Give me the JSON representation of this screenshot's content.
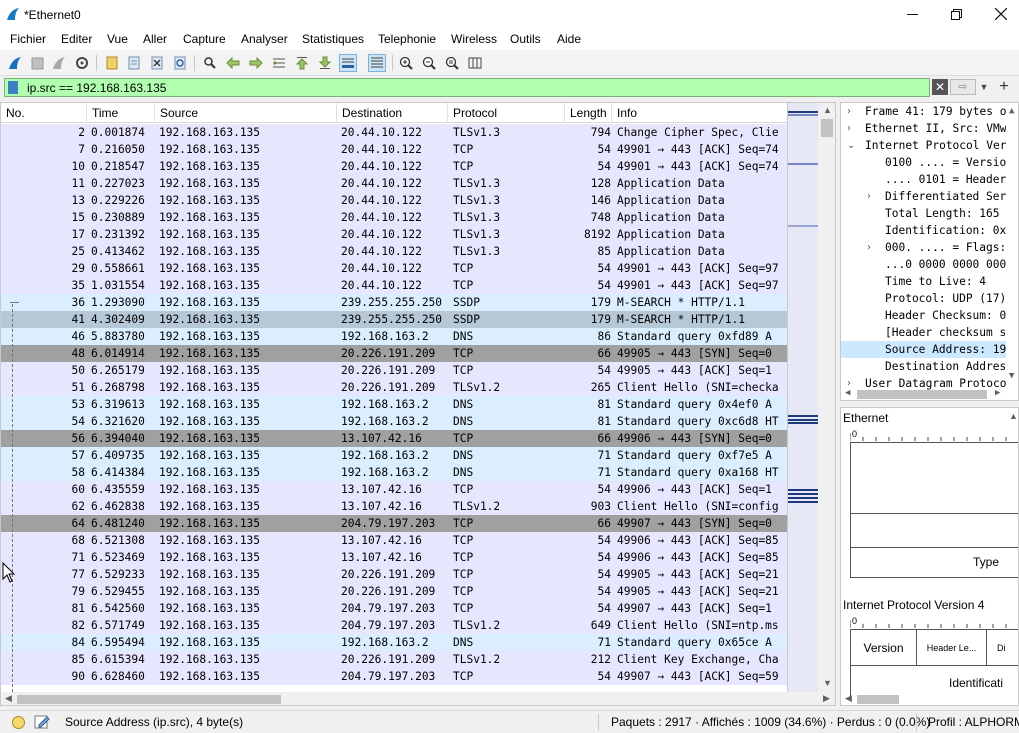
{
  "window": {
    "title": "*Ethernet0"
  },
  "menu": [
    "Fichier",
    "Editer",
    "Vue",
    "Aller",
    "Capture",
    "Analyser",
    "Statistiques",
    "Telephonie",
    "Wireless",
    "Outils",
    "Aide"
  ],
  "filter": {
    "value": "ip.src == 192.168.163.135",
    "apply_label": "⇨"
  },
  "columns": {
    "no": "No.",
    "time": "Time",
    "source": "Source",
    "destination": "Destination",
    "protocol": "Protocol",
    "length": "Length",
    "info": "Info"
  },
  "packets": [
    {
      "no": "2",
      "time": "0.001874",
      "src": "192.168.163.135",
      "dst": "20.44.10.122",
      "proto": "TLSv1.3",
      "len": "794",
      "info": "Change Cipher Spec, Clie",
      "bg": "#e7e6ff"
    },
    {
      "no": "7",
      "time": "0.216050",
      "src": "192.168.163.135",
      "dst": "20.44.10.122",
      "proto": "TCP",
      "len": "54",
      "info": "49901 → 443 [ACK] Seq=74",
      "bg": "#e7e6ff"
    },
    {
      "no": "10",
      "time": "0.218547",
      "src": "192.168.163.135",
      "dst": "20.44.10.122",
      "proto": "TCP",
      "len": "54",
      "info": "49901 → 443 [ACK] Seq=74",
      "bg": "#e7e6ff"
    },
    {
      "no": "11",
      "time": "0.227023",
      "src": "192.168.163.135",
      "dst": "20.44.10.122",
      "proto": "TLSv1.3",
      "len": "128",
      "info": "Application Data",
      "bg": "#e7e6ff"
    },
    {
      "no": "13",
      "time": "0.229226",
      "src": "192.168.163.135",
      "dst": "20.44.10.122",
      "proto": "TLSv1.3",
      "len": "146",
      "info": "Application Data",
      "bg": "#e7e6ff"
    },
    {
      "no": "15",
      "time": "0.230889",
      "src": "192.168.163.135",
      "dst": "20.44.10.122",
      "proto": "TLSv1.3",
      "len": "748",
      "info": "Application Data",
      "bg": "#e7e6ff"
    },
    {
      "no": "17",
      "time": "0.231392",
      "src": "192.168.163.135",
      "dst": "20.44.10.122",
      "proto": "TLSv1.3",
      "len": "8192",
      "info": "Application Data",
      "bg": "#e7e6ff"
    },
    {
      "no": "25",
      "time": "0.413462",
      "src": "192.168.163.135",
      "dst": "20.44.10.122",
      "proto": "TLSv1.3",
      "len": "85",
      "info": "Application Data",
      "bg": "#e7e6ff"
    },
    {
      "no": "29",
      "time": "0.558661",
      "src": "192.168.163.135",
      "dst": "20.44.10.122",
      "proto": "TCP",
      "len": "54",
      "info": "49901 → 443 [ACK] Seq=97",
      "bg": "#e7e6ff"
    },
    {
      "no": "35",
      "time": "1.031554",
      "src": "192.168.163.135",
      "dst": "20.44.10.122",
      "proto": "TCP",
      "len": "54",
      "info": "49901 → 443 [ACK] Seq=97",
      "bg": "#e7e6ff"
    },
    {
      "no": "36",
      "time": "1.293090",
      "src": "192.168.163.135",
      "dst": "239.255.255.250",
      "proto": "SSDP",
      "len": "179",
      "info": "M-SEARCH * HTTP/1.1",
      "bg": "#daeeff"
    },
    {
      "no": "41",
      "time": "4.302409",
      "src": "192.168.163.135",
      "dst": "239.255.255.250",
      "proto": "SSDP",
      "len": "179",
      "info": "M-SEARCH * HTTP/1.1",
      "bg": "#b6c8d6"
    },
    {
      "no": "46",
      "time": "5.883780",
      "src": "192.168.163.135",
      "dst": "192.168.163.2",
      "proto": "DNS",
      "len": "86",
      "info": "Standard query 0xfd89 A",
      "bg": "#daeeff"
    },
    {
      "no": "48",
      "time": "6.014914",
      "src": "192.168.163.135",
      "dst": "20.226.191.209",
      "proto": "TCP",
      "len": "66",
      "info": "49905 → 443 [SYN] Seq=0",
      "bg": "#a0a0a0"
    },
    {
      "no": "50",
      "time": "6.265179",
      "src": "192.168.163.135",
      "dst": "20.226.191.209",
      "proto": "TCP",
      "len": "54",
      "info": "49905 → 443 [ACK] Seq=1",
      "bg": "#e7e6ff"
    },
    {
      "no": "51",
      "time": "6.268798",
      "src": "192.168.163.135",
      "dst": "20.226.191.209",
      "proto": "TLSv1.2",
      "len": "265",
      "info": "Client Hello (SNI=checka",
      "bg": "#e7e6ff"
    },
    {
      "no": "53",
      "time": "6.319613",
      "src": "192.168.163.135",
      "dst": "192.168.163.2",
      "proto": "DNS",
      "len": "81",
      "info": "Standard query 0x4ef0 A",
      "bg": "#daeeff"
    },
    {
      "no": "54",
      "time": "6.321620",
      "src": "192.168.163.135",
      "dst": "192.168.163.2",
      "proto": "DNS",
      "len": "81",
      "info": "Standard query 0xc6d8 HT",
      "bg": "#daeeff"
    },
    {
      "no": "56",
      "time": "6.394040",
      "src": "192.168.163.135",
      "dst": "13.107.42.16",
      "proto": "TCP",
      "len": "66",
      "info": "49906 → 443 [SYN] Seq=0",
      "bg": "#a0a0a0"
    },
    {
      "no": "57",
      "time": "6.409735",
      "src": "192.168.163.135",
      "dst": "192.168.163.2",
      "proto": "DNS",
      "len": "71",
      "info": "Standard query 0xf7e5 A",
      "bg": "#daeeff"
    },
    {
      "no": "58",
      "time": "6.414384",
      "src": "192.168.163.135",
      "dst": "192.168.163.2",
      "proto": "DNS",
      "len": "71",
      "info": "Standard query 0xa168 HT",
      "bg": "#daeeff"
    },
    {
      "no": "60",
      "time": "6.435559",
      "src": "192.168.163.135",
      "dst": "13.107.42.16",
      "proto": "TCP",
      "len": "54",
      "info": "49906 → 443 [ACK] Seq=1",
      "bg": "#e7e6ff"
    },
    {
      "no": "62",
      "time": "6.462838",
      "src": "192.168.163.135",
      "dst": "13.107.42.16",
      "proto": "TLSv1.2",
      "len": "903",
      "info": "Client Hello (SNI=config",
      "bg": "#e7e6ff"
    },
    {
      "no": "64",
      "time": "6.481240",
      "src": "192.168.163.135",
      "dst": "204.79.197.203",
      "proto": "TCP",
      "len": "66",
      "info": "49907 → 443 [SYN] Seq=0",
      "bg": "#a0a0a0"
    },
    {
      "no": "68",
      "time": "6.521308",
      "src": "192.168.163.135",
      "dst": "13.107.42.16",
      "proto": "TCP",
      "len": "54",
      "info": "49906 → 443 [ACK] Seq=85",
      "bg": "#e7e6ff"
    },
    {
      "no": "71",
      "time": "6.523469",
      "src": "192.168.163.135",
      "dst": "13.107.42.16",
      "proto": "TCP",
      "len": "54",
      "info": "49906 → 443 [ACK] Seq=85",
      "bg": "#e7e6ff"
    },
    {
      "no": "77",
      "time": "6.529233",
      "src": "192.168.163.135",
      "dst": "20.226.191.209",
      "proto": "TCP",
      "len": "54",
      "info": "49905 → 443 [ACK] Seq=21",
      "bg": "#e7e6ff"
    },
    {
      "no": "79",
      "time": "6.529455",
      "src": "192.168.163.135",
      "dst": "20.226.191.209",
      "proto": "TCP",
      "len": "54",
      "info": "49905 → 443 [ACK] Seq=21",
      "bg": "#e7e6ff"
    },
    {
      "no": "81",
      "time": "6.542560",
      "src": "192.168.163.135",
      "dst": "204.79.197.203",
      "proto": "TCP",
      "len": "54",
      "info": "49907 → 443 [ACK] Seq=1",
      "bg": "#e7e6ff"
    },
    {
      "no": "82",
      "time": "6.571749",
      "src": "192.168.163.135",
      "dst": "204.79.197.203",
      "proto": "TLSv1.2",
      "len": "649",
      "info": "Client Hello (SNI=ntp.ms",
      "bg": "#e7e6ff"
    },
    {
      "no": "84",
      "time": "6.595494",
      "src": "192.168.163.135",
      "dst": "192.168.163.2",
      "proto": "DNS",
      "len": "71",
      "info": "Standard query 0x65ce A",
      "bg": "#daeeff"
    },
    {
      "no": "85",
      "time": "6.615394",
      "src": "192.168.163.135",
      "dst": "20.226.191.209",
      "proto": "TLSv1.2",
      "len": "212",
      "info": "Client Key Exchange, Cha",
      "bg": "#e7e6ff"
    },
    {
      "no": "90",
      "time": "6.628460",
      "src": "192.168.163.135",
      "dst": "204.79.197.203",
      "proto": "TCP",
      "len": "54",
      "info": "49907 → 443 [ACK] Seq=59",
      "bg": "#e7e6ff"
    }
  ],
  "details": [
    {
      "exp": "›",
      "x": 0,
      "text": "Frame 41: 179 bytes o"
    },
    {
      "exp": "›",
      "x": 0,
      "text": "Ethernet II, Src: VMw"
    },
    {
      "exp": "⌄",
      "x": 0,
      "text": "Internet Protocol Ver"
    },
    {
      "exp": "",
      "x": 2,
      "text": "0100 .... = Versio"
    },
    {
      "exp": "",
      "x": 2,
      "text": ".... 0101 = Header"
    },
    {
      "exp": "›",
      "x": 1,
      "text": "Differentiated Ser"
    },
    {
      "exp": "",
      "x": 2,
      "text": "Total Length: 165"
    },
    {
      "exp": "",
      "x": 2,
      "text": "Identification: 0x"
    },
    {
      "exp": "›",
      "x": 1,
      "text": "000. .... = Flags:"
    },
    {
      "exp": "",
      "x": 2,
      "text": "...0 0000 0000 000"
    },
    {
      "exp": "",
      "x": 2,
      "text": "Time to Live: 4"
    },
    {
      "exp": "",
      "x": 2,
      "text": "Protocol: UDP (17)"
    },
    {
      "exp": "",
      "x": 2,
      "text": "Header Checksum: 0"
    },
    {
      "exp": "",
      "x": 2,
      "text": "[Header checksum s"
    },
    {
      "exp": "",
      "x": 2,
      "text": "Source Address: 19",
      "sel": true
    },
    {
      "exp": "",
      "x": 2,
      "text": "Destination Addres"
    },
    {
      "exp": "›",
      "x": 0,
      "text": "User Datagram Protoco"
    }
  ],
  "bytes_pane": {
    "ethernet_label": "Ethernet",
    "ruler_zero": "0",
    "type_label": "Type",
    "ip_label": "Internet Protocol Version 4",
    "version_label": "Version",
    "header_len_label": "Header Le...",
    "di_label": "Di",
    "identification_label": "Identificati"
  },
  "status": {
    "field": "Source Address (ip.src), 4 byte(s)",
    "packets": "Paquets : 2917 · Affichés : 1009 (34.6%) · Perdus : 0 (0.0%)",
    "profile": "Profil : ALPHORM"
  }
}
